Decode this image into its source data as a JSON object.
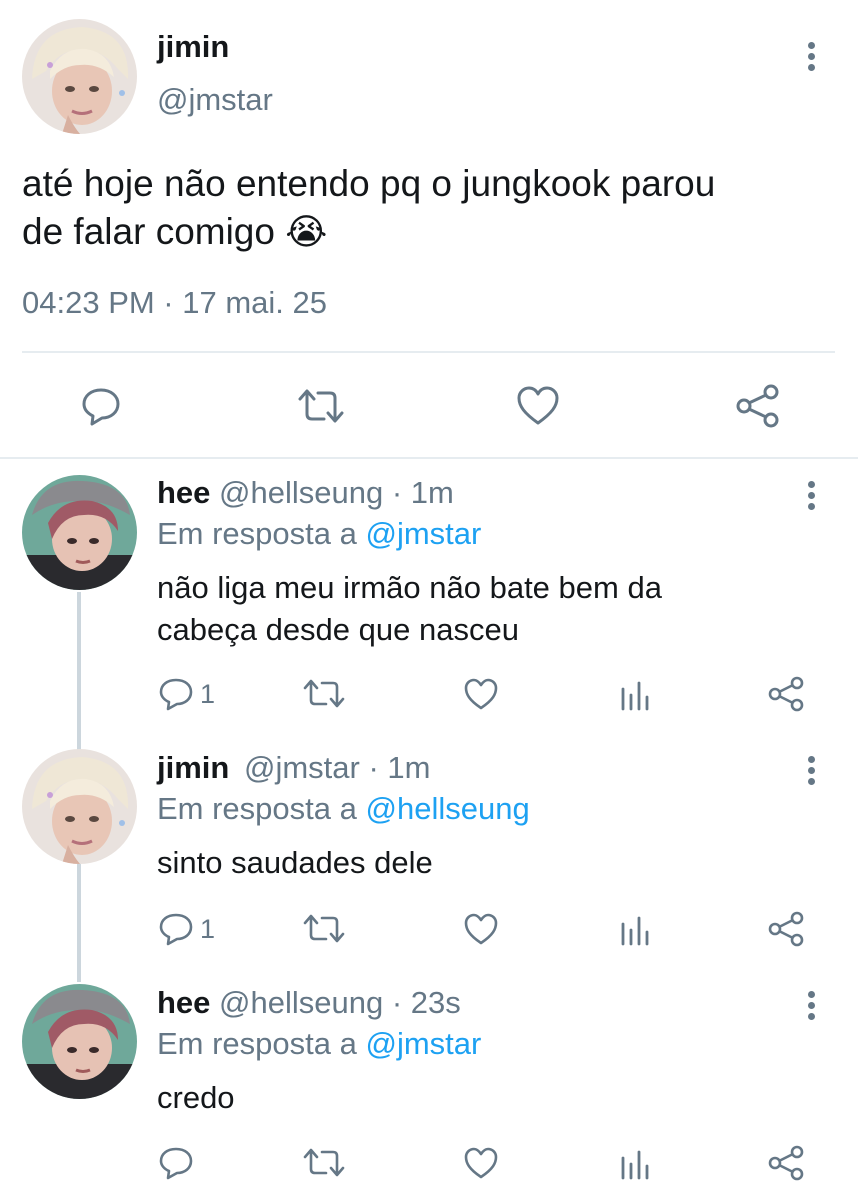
{
  "main_tweet": {
    "name": "jimin",
    "handle": "@jmstar",
    "text_line1": "até hoje não entendo pq o jungkook parou",
    "text_line2": "de falar comigo",
    "emoji": "😭",
    "timestamp": "04:23 PM · 17 mai. 25",
    "actions": [
      "reply-icon",
      "retweet-icon",
      "like-icon",
      "share-icon"
    ]
  },
  "replies": [
    {
      "name": "hee",
      "handle": "@hellseung",
      "time": "· 1m",
      "reply_prefix": "Em resposta a",
      "reply_to": "@jmstar",
      "text_line1": "não liga meu irmão não bate bem da",
      "text_line2": "cabeça desde que nasceu",
      "reply_count": "1"
    },
    {
      "name": "jimin",
      "handle": "@jmstar",
      "time": "· 1m",
      "reply_prefix": "Em resposta a",
      "reply_to": "@hellseung",
      "text_line1": "sinto saudades dele",
      "reply_count": "1"
    },
    {
      "name": "hee",
      "handle": "@hellseung",
      "time": "· 23s",
      "reply_prefix": "Em resposta a",
      "reply_to": "@jmstar",
      "text_line1": "credo",
      "reply_count": ""
    }
  ],
  "colors": {
    "text": "#14171a",
    "muted": "#657786",
    "link": "#1da1f2",
    "divider": "#e6ecf0"
  }
}
